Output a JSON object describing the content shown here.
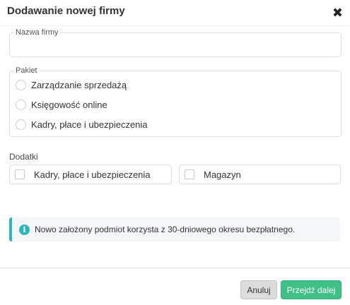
{
  "modal": {
    "title": "Dodawanie nowej firmy",
    "close_glyph": "✖"
  },
  "company_name": {
    "label": "Nazwa firmy",
    "value": ""
  },
  "package": {
    "label": "Pakiet",
    "options": [
      {
        "label": "Zarządzanie sprzedażą",
        "selected": false
      },
      {
        "label": "Księgowość online",
        "selected": false
      },
      {
        "label": "Kadry, płace i ubezpieczenia",
        "selected": false
      }
    ]
  },
  "addons": {
    "label": "Dodatki",
    "items": [
      {
        "label": "Kadry, płace i ubezpieczenia",
        "checked": false
      },
      {
        "label": "Magazyn",
        "checked": false
      }
    ]
  },
  "info": {
    "icon": "info-icon",
    "icon_glyph": "i",
    "text": "Nowo założony podmiot korzysta z 30-dniowego okresu bezpłatnego."
  },
  "footer": {
    "cancel_label": "Anuluj",
    "next_label": "Przejdź dalej"
  },
  "colors": {
    "accent_info": "#2fb5c1",
    "primary_button": "#3ec087",
    "secondary_button": "#dcdcdc"
  }
}
